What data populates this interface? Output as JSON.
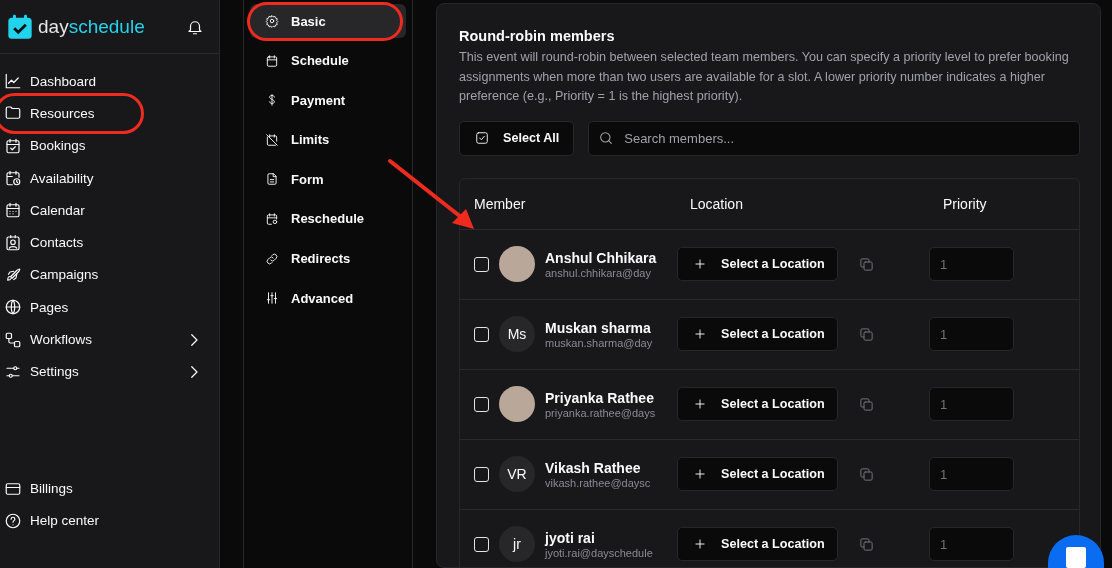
{
  "brand": {
    "part_1": "day",
    "part_2": "schedule"
  },
  "sidebar": {
    "items": [
      {
        "label": "Dashboard",
        "selected": false,
        "circled": false,
        "expandable": false
      },
      {
        "label": "Resources",
        "selected": false,
        "circled": true,
        "expandable": false
      },
      {
        "label": "Bookings",
        "selected": false,
        "circled": false,
        "expandable": false
      },
      {
        "label": "Availability",
        "selected": false,
        "circled": false,
        "expandable": false
      },
      {
        "label": "Calendar",
        "selected": false,
        "circled": false,
        "expandable": false
      },
      {
        "label": "Contacts",
        "selected": false,
        "circled": false,
        "expandable": false
      },
      {
        "label": "Campaigns",
        "selected": false,
        "circled": false,
        "expandable": false
      },
      {
        "label": "Pages",
        "selected": false,
        "circled": false,
        "expandable": false
      },
      {
        "label": "Workflows",
        "selected": false,
        "circled": false,
        "expandable": true
      },
      {
        "label": "Settings",
        "selected": false,
        "circled": false,
        "expandable": true
      }
    ],
    "bottom_items": [
      {
        "label": "Billings"
      },
      {
        "label": "Help center"
      }
    ]
  },
  "event_nav": {
    "items": [
      {
        "label": "Basic",
        "selected": true,
        "circled": true
      },
      {
        "label": "Schedule",
        "selected": false,
        "circled": false
      },
      {
        "label": "Payment",
        "selected": false,
        "circled": false
      },
      {
        "label": "Limits",
        "selected": false,
        "circled": false
      },
      {
        "label": "Form",
        "selected": false,
        "circled": false
      },
      {
        "label": "Reschedule",
        "selected": false,
        "circled": false
      },
      {
        "label": "Redirects",
        "selected": false,
        "circled": false
      },
      {
        "label": "Advanced",
        "selected": false,
        "circled": false
      }
    ]
  },
  "members_section": {
    "title": "Round-robin members",
    "description": "This event will round-robin between selected team members. You can specify a priority level to prefer booking assignments when more than two users are available for a slot. A lower priority number indicates a higher preference (e.g., Priority = 1 is the highest priority).",
    "select_all": "Select All",
    "search": {
      "placeholder": "Search members..."
    },
    "table": {
      "columns": [
        "Member",
        "Location",
        "Priority"
      ],
      "rows": [
        {
          "name": "Anshul Chhikara",
          "email": "anshul.chhikara@day",
          "avatar": {
            "kind": "photo"
          },
          "checked": false,
          "location": "Select a Location",
          "priority": "1"
        },
        {
          "name": "Muskan sharma",
          "email": "muskan.sharma@day",
          "avatar": {
            "kind": "initials",
            "initials": "Ms"
          },
          "checked": false,
          "location": "Select a Location",
          "priority": "1"
        },
        {
          "name": "Priyanka Rathee",
          "email": "priyanka.rathee@days",
          "avatar": {
            "kind": "photo"
          },
          "checked": false,
          "location": "Select a Location",
          "priority": "1"
        },
        {
          "name": "Vikash Rathee",
          "email": "vikash.rathee@daysc",
          "avatar": {
            "kind": "initials",
            "initials": "VR"
          },
          "checked": false,
          "location": "Select a Location",
          "priority": "1"
        },
        {
          "name": "jyoti rai",
          "email": "jyoti.rai@dayschedule",
          "avatar": {
            "kind": "initials",
            "initials": "jr"
          },
          "checked": false,
          "location": "Select a Location",
          "priority": "1"
        }
      ]
    }
  }
}
